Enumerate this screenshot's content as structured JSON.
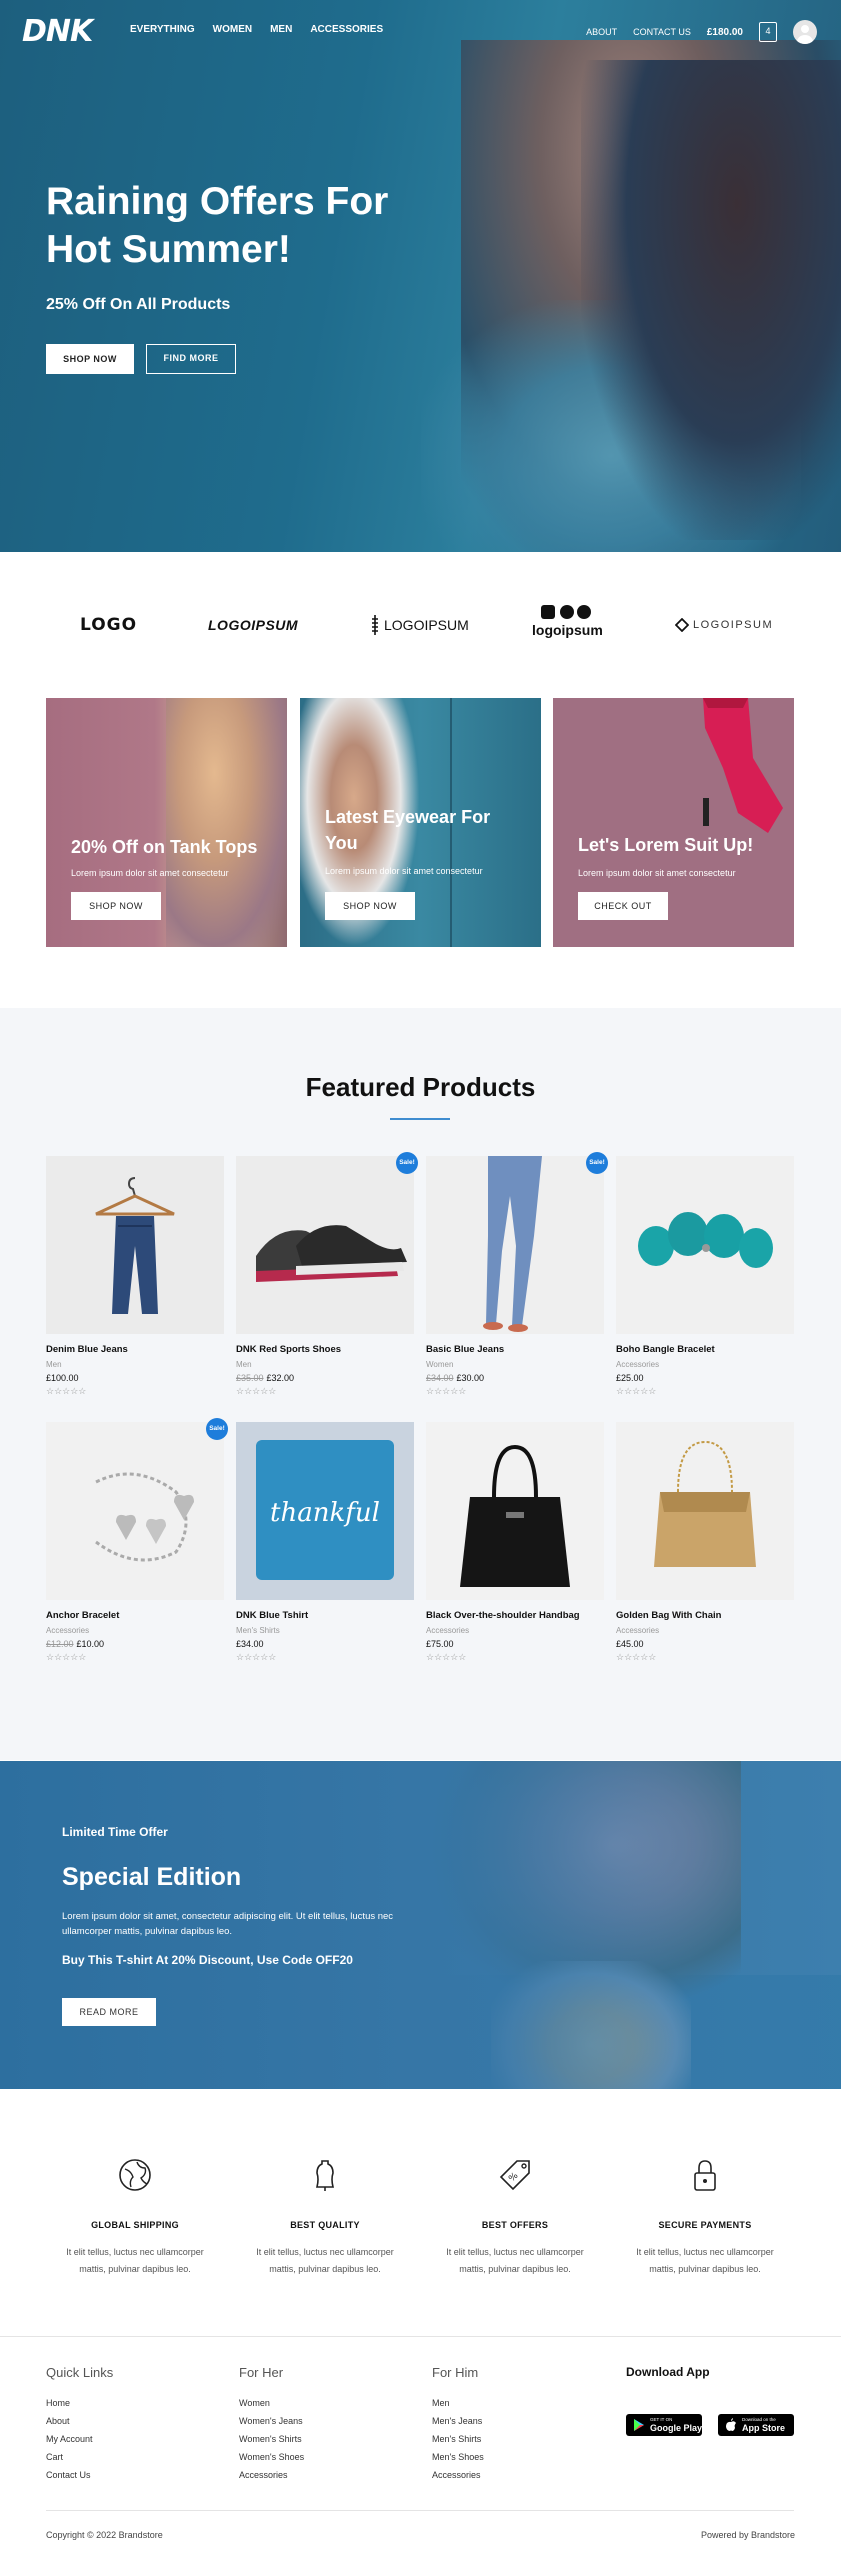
{
  "header": {
    "logo": "DNK",
    "nav_left": [
      "EVERYTHING",
      "WOMEN",
      "MEN",
      "ACCESSORIES"
    ],
    "nav_right": [
      "ABOUT",
      "CONTACT US"
    ],
    "cart_total": "£180.00",
    "cart_count": "4"
  },
  "hero": {
    "title": "Raining Offers For Hot Summer!",
    "subtitle": "25% Off On All Products",
    "btn_primary": "SHOP NOW",
    "btn_secondary": "FIND MORE"
  },
  "brands": [
    "LOGO",
    "LOGOIPSUM",
    "LOGOIPSUM",
    "logoipsum",
    "LOGOIPSUM"
  ],
  "promos": [
    {
      "title": "20% Off on Tank Tops",
      "text": "Lorem ipsum dolor sit amet consectetur",
      "button": "SHOP NOW"
    },
    {
      "title": "Latest Eyewear For You",
      "text": "Lorem ipsum dolor sit amet consectetur",
      "button": "SHOP NOW"
    },
    {
      "title": "Let's Lorem Suit Up!",
      "text": "Lorem ipsum dolor sit amet consectetur",
      "button": "CHECK OUT"
    }
  ],
  "featured": {
    "title": "Featured Products",
    "sale_label": "Sale!",
    "stars": "☆☆☆☆☆",
    "products": [
      {
        "name": "Denim Blue Jeans",
        "category": "Men",
        "old_price": "",
        "price": "£100.00",
        "sale": false
      },
      {
        "name": "DNK Red Sports Shoes",
        "category": "Men",
        "old_price": "£35.00",
        "price": "£32.00",
        "sale": true
      },
      {
        "name": "Basic Blue Jeans",
        "category": "Women",
        "old_price": "£34.00",
        "price": "£30.00",
        "sale": true
      },
      {
        "name": "Boho Bangle Bracelet",
        "category": "Accessories",
        "old_price": "",
        "price": "£25.00",
        "sale": false
      },
      {
        "name": "Anchor Bracelet",
        "category": "Accessories",
        "old_price": "£12.00",
        "price": "£10.00",
        "sale": true
      },
      {
        "name": "DNK Blue Tshirt",
        "category": "Men's Shirts",
        "old_price": "",
        "price": "£34.00",
        "sale": false
      },
      {
        "name": "Black Over-the-shoulder Handbag",
        "category": "Accessories",
        "old_price": "",
        "price": "£75.00",
        "sale": false
      },
      {
        "name": "Golden Bag With Chain",
        "category": "Accessories",
        "old_price": "",
        "price": "£45.00",
        "sale": false
      }
    ],
    "tshirt_text": "thankful"
  },
  "special": {
    "kicker": "Limited Time Offer",
    "title": "Special Edition",
    "text": "Lorem ipsum dolor sit amet, consectetur adipiscing elit. Ut elit tellus, luctus nec ullamcorper mattis, pulvinar dapibus leo.",
    "offer": "Buy This T-shirt At 20% Discount, Use Code OFF20",
    "button": "READ MORE"
  },
  "features": [
    {
      "title": "GLOBAL SHIPPING",
      "text": "It elit tellus, luctus nec ullamcorper mattis, pulvinar dapibus leo."
    },
    {
      "title": "BEST QUALITY",
      "text": "It elit tellus, luctus nec ullamcorper mattis, pulvinar dapibus leo."
    },
    {
      "title": "BEST OFFERS",
      "text": "It elit tellus, luctus nec ullamcorper mattis, pulvinar dapibus leo."
    },
    {
      "title": "SECURE PAYMENTS",
      "text": "It elit tellus, luctus nec ullamcorper mattis, pulvinar dapibus leo."
    }
  ],
  "footer": {
    "quick_links": {
      "title": "Quick Links",
      "items": [
        "Home",
        "About",
        "My Account",
        "Cart",
        "Contact Us"
      ]
    },
    "for_her": {
      "title": "For Her",
      "items": [
        "Women",
        "Women's Jeans",
        "Women's Shirts",
        "Women's Shoes",
        "Accessories"
      ]
    },
    "for_him": {
      "title": "For Him",
      "items": [
        "Men",
        "Men's Jeans",
        "Men's Shirts",
        "Men's Shoes",
        "Accessories"
      ]
    },
    "download": {
      "title": "Download App",
      "google_small": "GET IT ON",
      "google": "Google Play",
      "apple_small": "Download on the",
      "apple": "App Store"
    },
    "copyright": "Copyright © 2022 Brandstore",
    "powered": "Powered by Brandstore"
  }
}
